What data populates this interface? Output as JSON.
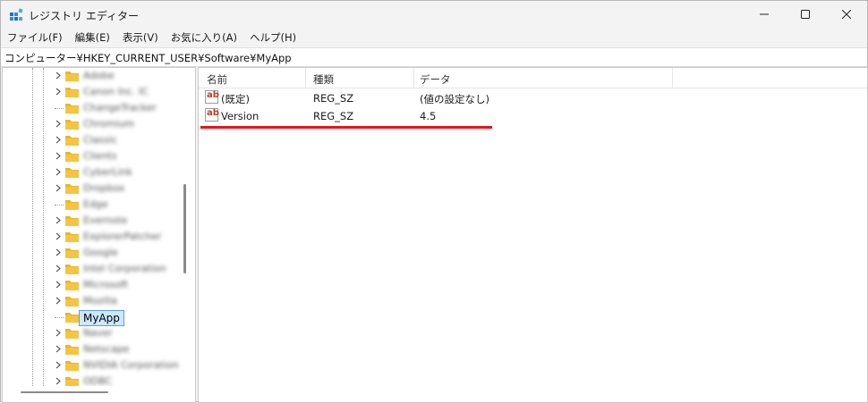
{
  "window": {
    "title": "レジストリ エディター",
    "accent": "#1a73c9"
  },
  "menu": [
    "ファイル(F)",
    "編集(E)",
    "表示(V)",
    "お気に入り(A)",
    "ヘルプ(H)"
  ],
  "address": "コンピューター¥HKEY_CURRENT_USER¥Software¥MyApp",
  "tree": {
    "items": [
      {
        "label": "Adobe",
        "expandable": true,
        "blurred": true
      },
      {
        "label": "Canon Inc. IC",
        "expandable": true,
        "blurred": true
      },
      {
        "label": "ChangeTracker",
        "expandable": false,
        "blurred": true
      },
      {
        "label": "Chromium",
        "expandable": true,
        "blurred": true
      },
      {
        "label": "Classic",
        "expandable": true,
        "blurred": true
      },
      {
        "label": "Clients",
        "expandable": true,
        "blurred": true
      },
      {
        "label": "CyberLink",
        "expandable": true,
        "blurred": true
      },
      {
        "label": "Dropbox",
        "expandable": true,
        "blurred": true
      },
      {
        "label": "Edge",
        "expandable": false,
        "blurred": true
      },
      {
        "label": "Evernote",
        "expandable": true,
        "blurred": true
      },
      {
        "label": "ExplorerPatcher",
        "expandable": true,
        "blurred": true
      },
      {
        "label": "Google",
        "expandable": true,
        "blurred": true
      },
      {
        "label": "Intel Corporation",
        "expandable": true,
        "blurred": true
      },
      {
        "label": "Microsoft",
        "expandable": true,
        "blurred": true
      },
      {
        "label": "Mozilla",
        "expandable": true,
        "blurred": true
      },
      {
        "label": "MyApp",
        "expandable": false,
        "blurred": false,
        "selected": true
      },
      {
        "label": "Naver",
        "expandable": true,
        "blurred": true
      },
      {
        "label": "Netscape",
        "expandable": true,
        "blurred": true
      },
      {
        "label": "NVIDIA Corporation",
        "expandable": true,
        "blurred": true
      },
      {
        "label": "ODBC",
        "expandable": true,
        "blurred": true
      }
    ]
  },
  "list": {
    "columns": [
      "名前",
      "種類",
      "データ"
    ],
    "rows": [
      {
        "name": "(既定)",
        "type": "REG_SZ",
        "data": "(値の設定なし)"
      },
      {
        "name": "Version",
        "type": "REG_SZ",
        "data": "4.5"
      }
    ]
  },
  "icons": {
    "app": "registry-icon",
    "folder": "folder-icon",
    "value": "string-value-icon",
    "ab_text": "ab"
  },
  "colors": {
    "folder": "#f5c542",
    "selection": "#cce8ff",
    "highlight_line": "#e8141c",
    "value_icon_text": "#c0392b"
  }
}
